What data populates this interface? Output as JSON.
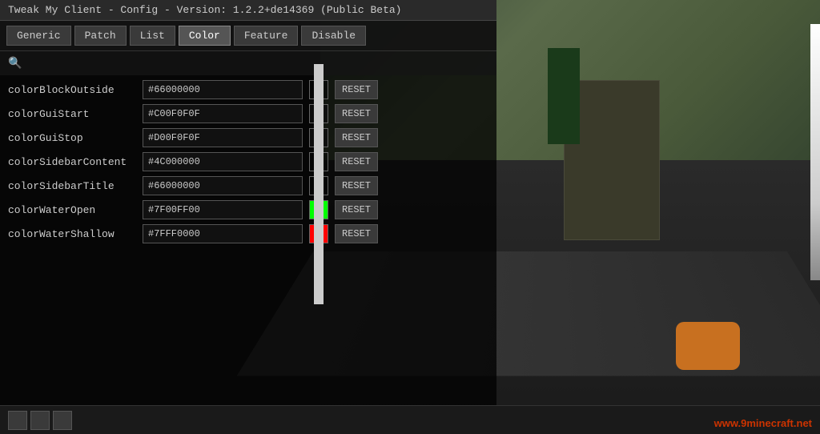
{
  "window": {
    "title": "Tweak My Client - Config - Version: 1.2.2+de14369 (Public Beta)"
  },
  "tabs": [
    {
      "label": "Generic",
      "id": "generic",
      "active": false
    },
    {
      "label": "Patch",
      "id": "patch",
      "active": false
    },
    {
      "label": "List",
      "id": "list",
      "active": false
    },
    {
      "label": "Color",
      "id": "color",
      "active": true
    },
    {
      "label": "Feature",
      "id": "feature",
      "active": false
    },
    {
      "label": "Disable",
      "id": "disable",
      "active": false
    }
  ],
  "search": {
    "icon": "🔍",
    "placeholder": ""
  },
  "config_rows": [
    {
      "label": "colorBlockOutside",
      "value": "#66000000",
      "swatch_color": "#000000",
      "swatch_opacity": 0.4
    },
    {
      "label": "colorGuiStart",
      "value": "#C00F0F0F",
      "swatch_color": "#0f0f0f",
      "swatch_opacity": 0.75
    },
    {
      "label": "colorGuiStop",
      "value": "#D00F0F0F",
      "swatch_color": "#0f0f0f",
      "swatch_opacity": 0.82
    },
    {
      "label": "colorSidebarContent",
      "value": "#4C000000",
      "swatch_color": "#000000",
      "swatch_opacity": 0.3
    },
    {
      "label": "colorSidebarTitle",
      "value": "#66000000",
      "swatch_color": "#000000",
      "swatch_opacity": 0.4
    },
    {
      "label": "colorWaterOpen",
      "value": "#7F00FF00",
      "swatch_color": "#00ff00",
      "swatch_opacity": 0.5
    },
    {
      "label": "colorWaterShallow",
      "value": "#7FFF0000",
      "swatch_color": "#ff0000",
      "swatch_opacity": 0.5
    }
  ],
  "swatch_colors_css": [
    "rgba(0,0,0,0.4)",
    "rgba(15,15,15,0.75)",
    "rgba(15,15,15,0.82)",
    "rgba(0,0,0,0.3)",
    "rgba(0,0,0,0.4)",
    "rgba(0,255,0,0.5)",
    "rgba(255,0,0,0.5)"
  ],
  "reset_label": "RESET",
  "bottom": {
    "watermark": "www.9minecraft.net"
  }
}
